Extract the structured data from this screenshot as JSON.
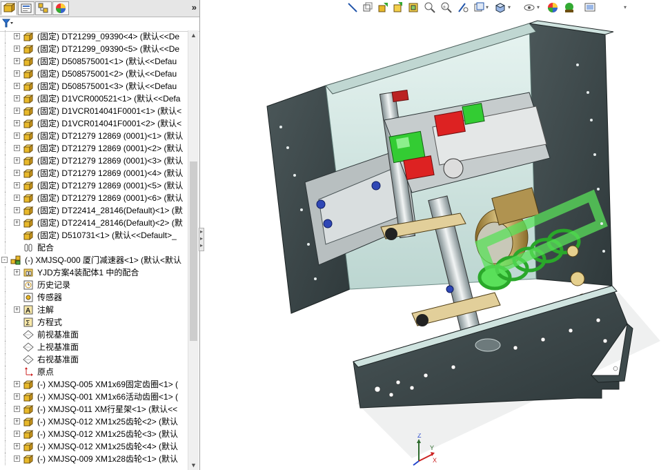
{
  "panel": {
    "expand_label": "»",
    "tabs": [
      {
        "name": "featuremanager-tab-icon"
      },
      {
        "name": "propertymanager-tab-icon"
      },
      {
        "name": "configurationmanager-tab-icon"
      },
      {
        "name": "displaymanager-tab-icon"
      }
    ],
    "filter_label": "▼"
  },
  "tree": [
    {
      "label": "(固定) DT21299_09390<4> (默认<<De",
      "icon": "part-icon",
      "depth": 1,
      "expander": "+"
    },
    {
      "label": "(固定) DT21299_09390<5> (默认<<De",
      "icon": "part-icon",
      "depth": 1,
      "expander": "+"
    },
    {
      "label": "(固定) D508575001<1> (默认<<Defau",
      "icon": "part-icon",
      "depth": 1,
      "expander": "+"
    },
    {
      "label": "(固定) D508575001<2> (默认<<Defau",
      "icon": "part-icon",
      "depth": 1,
      "expander": "+"
    },
    {
      "label": "(固定) D508575001<3> (默认<<Defau",
      "icon": "part-icon",
      "depth": 1,
      "expander": "+"
    },
    {
      "label": "(固定) D1VCR000521<1> (默认<<Defa",
      "icon": "part-icon",
      "depth": 1,
      "expander": "+"
    },
    {
      "label": "(固定) D1VCR014041F0001<1> (默认<",
      "icon": "part-icon",
      "depth": 1,
      "expander": "+"
    },
    {
      "label": "(固定) D1VCR014041F0001<2> (默认<",
      "icon": "part-icon",
      "depth": 1,
      "expander": "+"
    },
    {
      "label": "(固定) DT21279 12869 (0001)<1> (默认",
      "icon": "part-icon",
      "depth": 1,
      "expander": "+"
    },
    {
      "label": "(固定) DT21279 12869 (0001)<2> (默认",
      "icon": "part-icon",
      "depth": 1,
      "expander": "+"
    },
    {
      "label": "(固定) DT21279 12869 (0001)<3> (默认",
      "icon": "part-icon",
      "depth": 1,
      "expander": "+"
    },
    {
      "label": "(固定) DT21279 12869 (0001)<4> (默认",
      "icon": "part-icon",
      "depth": 1,
      "expander": "+"
    },
    {
      "label": "(固定) DT21279 12869 (0001)<5> (默认",
      "icon": "part-icon",
      "depth": 1,
      "expander": "+"
    },
    {
      "label": "(固定) DT21279 12869 (0001)<6> (默认",
      "icon": "part-icon",
      "depth": 1,
      "expander": "+"
    },
    {
      "label": "(固定) DT22414_28146(Default)<1> (默",
      "icon": "part-icon",
      "depth": 1,
      "expander": "+"
    },
    {
      "label": "(固定) DT22414_28146(Default)<2> (默",
      "icon": "part-icon",
      "depth": 1,
      "expander": "+"
    },
    {
      "label": "(固定) D510731<1> (默认<<Default>_",
      "icon": "part-icon",
      "depth": 1,
      "expander": ""
    },
    {
      "label": "配合",
      "icon": "mates-icon",
      "depth": 1,
      "expander": ""
    },
    {
      "label": "(-) XMJSQ-000 厦门减速器<1> (默认<默认",
      "icon": "assembly-icon",
      "depth": 0,
      "expander": "-"
    },
    {
      "label": "YJD方案4装配体1 中的配合",
      "icon": "mates-folder-icon",
      "depth": 1,
      "expander": "+"
    },
    {
      "label": "历史记录",
      "icon": "history-icon",
      "depth": 1,
      "expander": ""
    },
    {
      "label": "传感器",
      "icon": "sensor-icon",
      "depth": 1,
      "expander": ""
    },
    {
      "label": "注解",
      "icon": "annotation-icon",
      "depth": 1,
      "expander": "+"
    },
    {
      "label": "方程式",
      "icon": "equation-icon",
      "depth": 1,
      "expander": ""
    },
    {
      "label": "前视基准面",
      "icon": "plane-icon",
      "depth": 1,
      "expander": ""
    },
    {
      "label": "上视基准面",
      "icon": "plane-icon",
      "depth": 1,
      "expander": ""
    },
    {
      "label": "右视基准面",
      "icon": "plane-icon",
      "depth": 1,
      "expander": ""
    },
    {
      "label": "原点",
      "icon": "origin-icon",
      "depth": 1,
      "expander": ""
    },
    {
      "label": "(-) XMJSQ-005 XM1x69固定齿圈<1> (",
      "icon": "part-icon",
      "depth": 1,
      "expander": "+"
    },
    {
      "label": "(-) XMJSQ-001 XM1x66活动齿圈<1> (",
      "icon": "part-icon",
      "depth": 1,
      "expander": "+"
    },
    {
      "label": "(-) XMJSQ-011 XM行星架<1> (默认<<",
      "icon": "part-icon",
      "depth": 1,
      "expander": "+"
    },
    {
      "label": "(-) XMJSQ-012 XM1x25齿轮<2> (默认",
      "icon": "part-icon",
      "depth": 1,
      "expander": "+"
    },
    {
      "label": "(-) XMJSQ-012 XM1x25齿轮<3> (默认",
      "icon": "part-icon",
      "depth": 1,
      "expander": "+"
    },
    {
      "label": "(-) XMJSQ-012 XM1x25齿轮<4> (默认",
      "icon": "part-icon",
      "depth": 1,
      "expander": "+"
    },
    {
      "label": "(-) XMJSQ-009 XM1x28齿轮<1> (默认",
      "icon": "part-icon",
      "depth": 1,
      "expander": "+"
    }
  ],
  "toolbar": [
    {
      "name": "sketch-line-icon"
    },
    {
      "name": "view-orientation-icon"
    },
    {
      "name": "previous-view-icon"
    },
    {
      "name": "zoom-to-fit-icon"
    },
    {
      "name": "zoom-to-area-icon"
    },
    {
      "name": "zoom-in-out-icon"
    },
    {
      "name": "rotate-view-icon"
    },
    {
      "name": "section-view-icon"
    },
    {
      "name": "view-orientation-dropdown-icon"
    },
    {
      "name": "display-style-icon"
    },
    {
      "name": "hide-show-items-icon"
    },
    {
      "name": "edit-appearance-icon"
    },
    {
      "name": "apply-scene-icon"
    },
    {
      "name": "view-settings-icon"
    }
  ],
  "triad": {
    "x": "X",
    "y": "Y",
    "z": "Z"
  },
  "colors": {
    "panel_bg": "#ffffff",
    "frame": "#3a4548",
    "frame_light": "#c9ddd9",
    "green": "#33cc33",
    "red": "#dd2222",
    "spring": "#5ae05a"
  }
}
